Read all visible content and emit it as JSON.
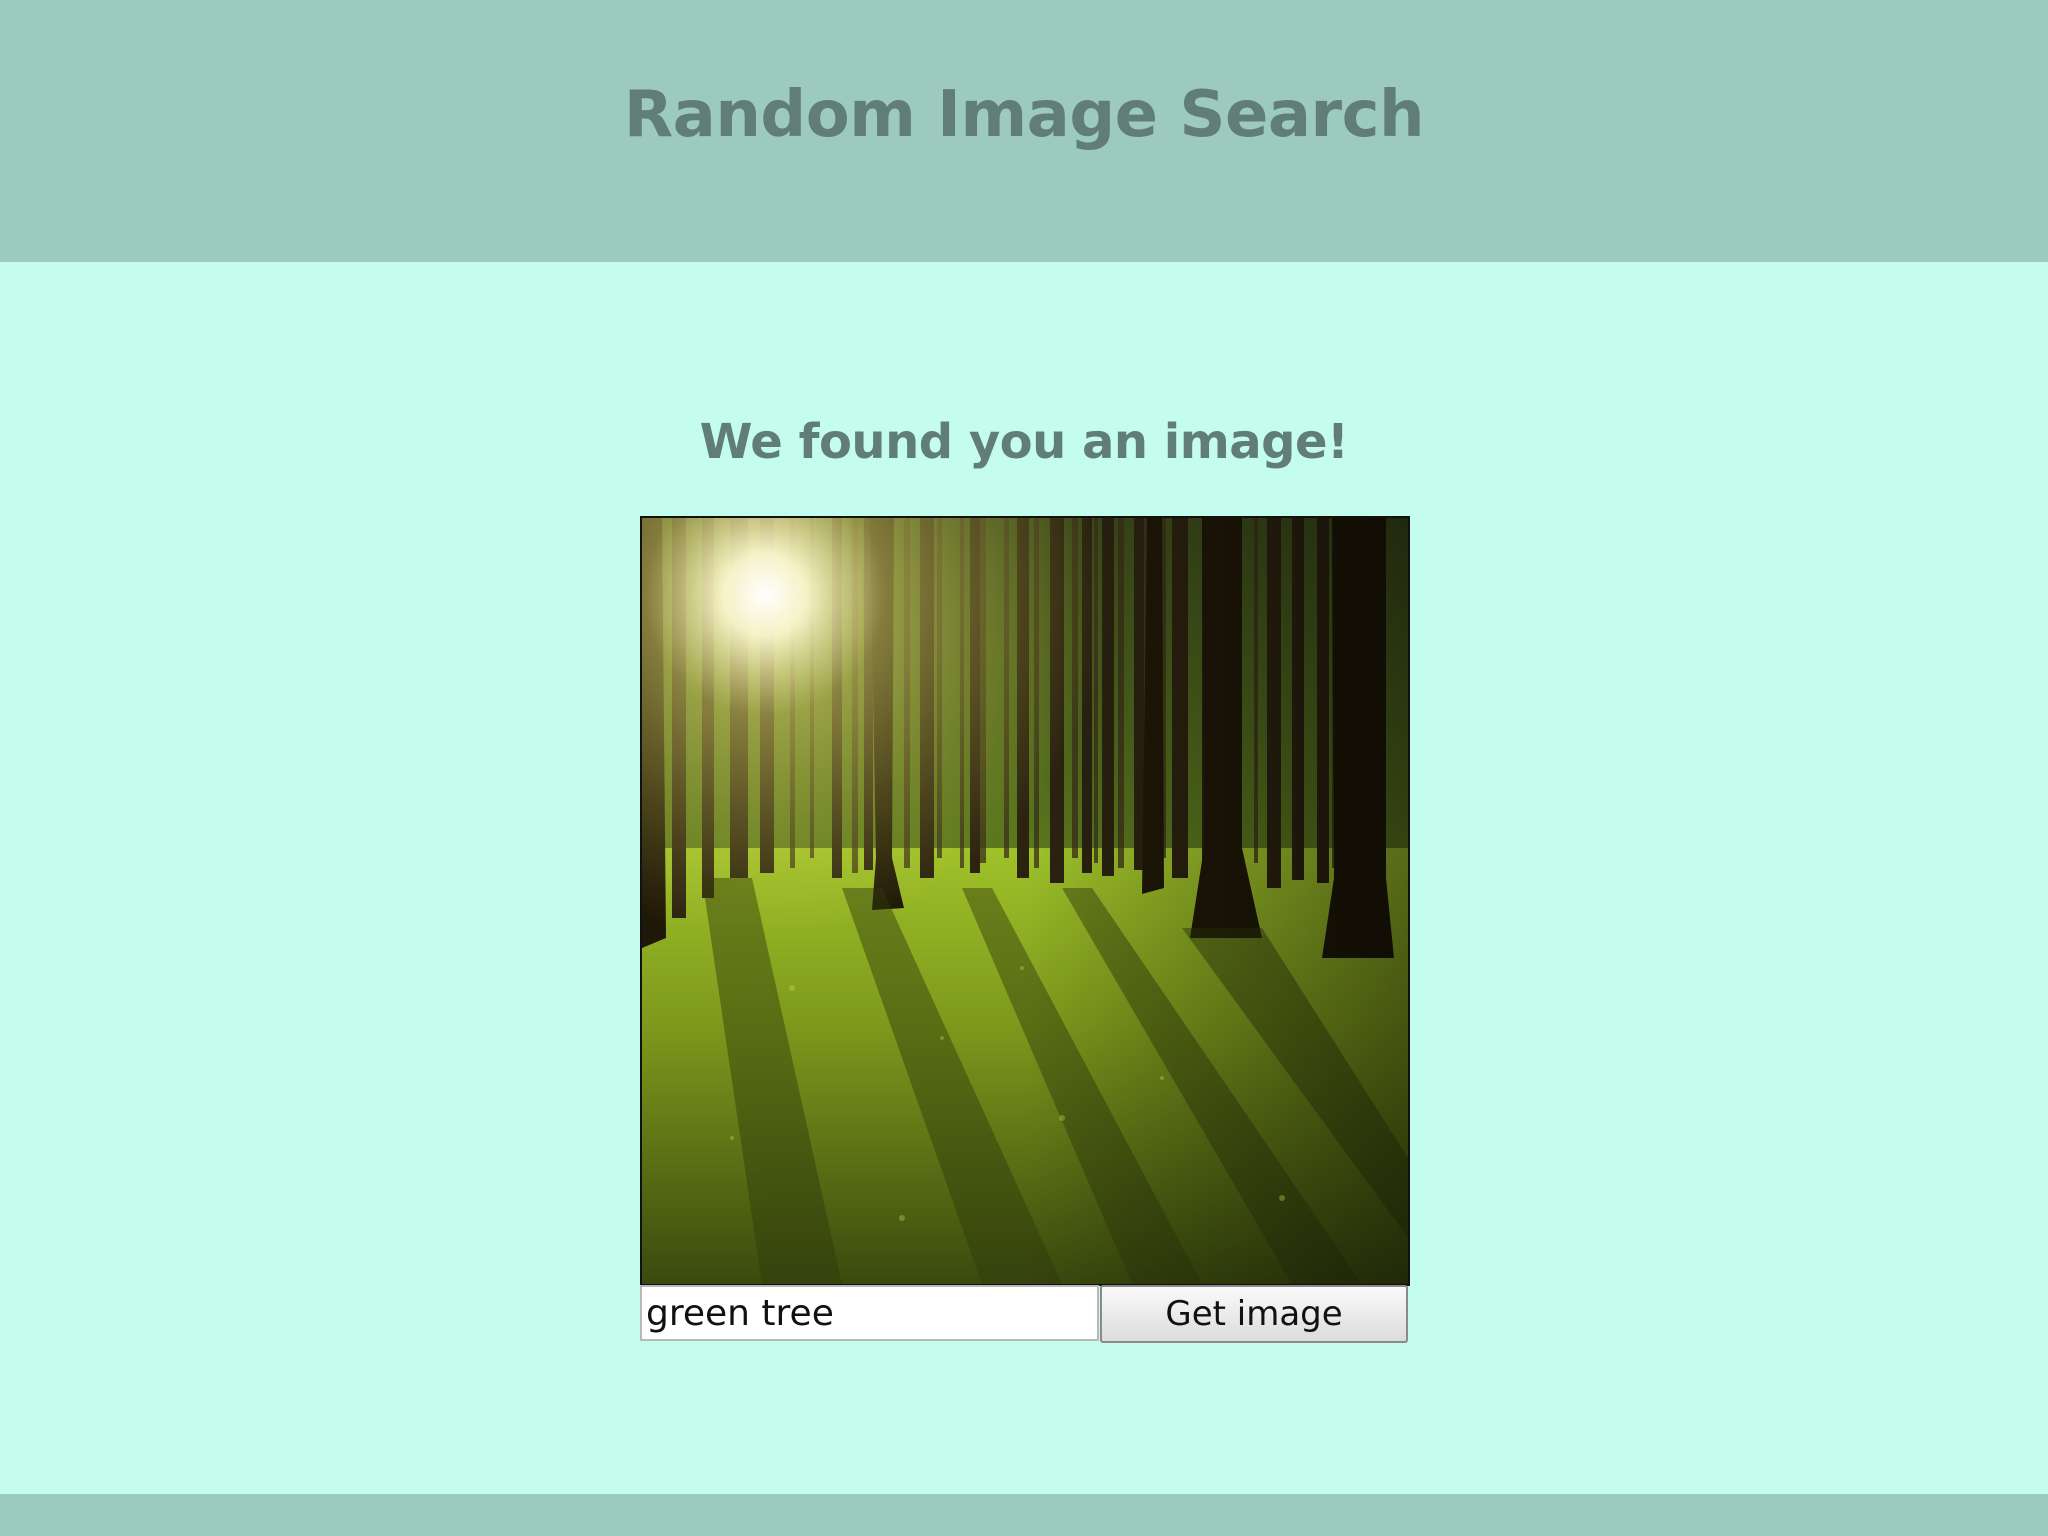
{
  "header": {
    "title": "Random Image Search"
  },
  "main": {
    "heading": "We found you an image!",
    "image": {
      "subject": "forest with sunlight and mossy ground"
    },
    "search": {
      "value": "green tree",
      "button_label": "Get image"
    }
  },
  "colors": {
    "header_bg": "#9ccbbe",
    "page_bg": "#c4fdec",
    "heading_text": "#607e76"
  }
}
